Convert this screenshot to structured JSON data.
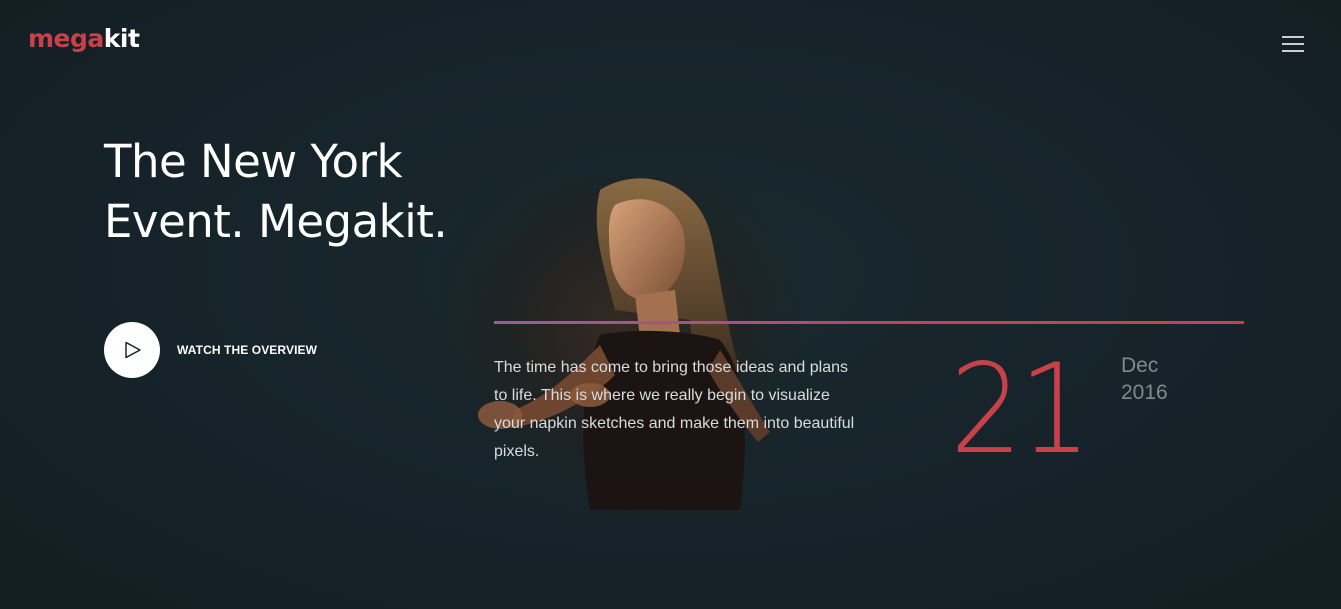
{
  "brand": {
    "logo_part1": "mega",
    "logo_part2": "kit",
    "accent_color": "#c8414a"
  },
  "header": {
    "menu_icon": "hamburger-icon"
  },
  "hero": {
    "headline_line1": "The New York",
    "headline_line2": "Event. Megakit.",
    "watch_label": "WATCH THE OVERVIEW",
    "play_icon": "play-icon",
    "description": "The time has come to bring those ideas and plans to life. This is where we really begin to visualize your napkin sketches and make them into beautiful pixels.",
    "date": {
      "day": "21",
      "month": "Dec",
      "year": "2016"
    }
  },
  "colors": {
    "background": "#17252a",
    "divider_start": "#9b5aa9",
    "divider_end": "#c8414a"
  }
}
